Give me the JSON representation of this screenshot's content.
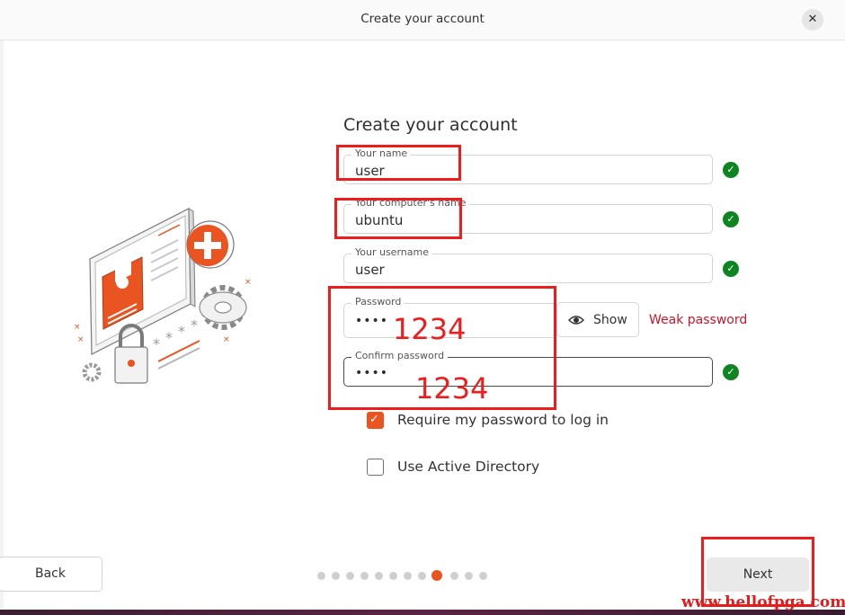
{
  "window": {
    "title": "Create your account",
    "close_glyph": "✕"
  },
  "form": {
    "heading": "Create your account",
    "your_name": {
      "label": "Your name",
      "value": "user"
    },
    "computer_name": {
      "label": "Your computer's name",
      "value": "ubuntu"
    },
    "username": {
      "label": "Your username",
      "value": "user"
    },
    "password": {
      "label": "Password",
      "value": "••••",
      "show_label": "Show",
      "strength": "Weak password"
    },
    "confirm_password": {
      "label": "Confirm password",
      "value": "••••"
    },
    "require_password": {
      "label": "Require my password to log in",
      "checked": true
    },
    "active_directory": {
      "label": "Use Active Directory",
      "checked": false
    }
  },
  "nav": {
    "back_label": "Back",
    "next_label": "Next",
    "steps_total": 12,
    "current_step": 9
  },
  "annotations": {
    "password_note": "1234",
    "confirm_note": "1234",
    "watermark": "www.hellofpga.com"
  },
  "colors": {
    "accent": "#e95420",
    "valid": "#0e8420",
    "warning_text": "#c7162b",
    "annotation": "#ee1c1c"
  },
  "icons": [
    "close-icon",
    "check-circle-icon",
    "eye-icon",
    "checkbox-check-icon",
    "account-illustration"
  ]
}
